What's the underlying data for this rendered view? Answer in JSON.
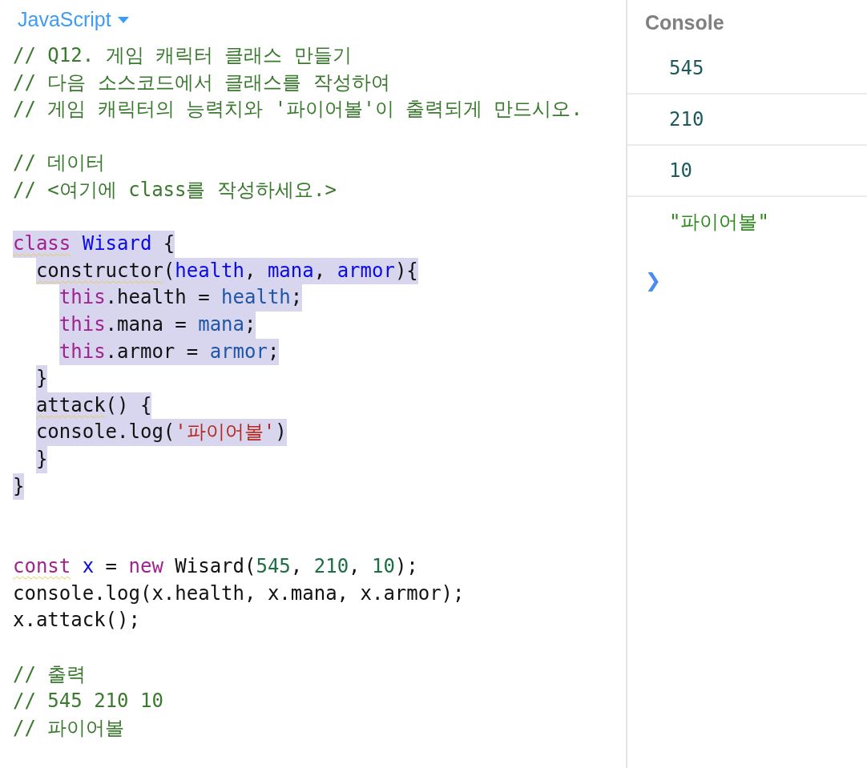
{
  "editor": {
    "language": "JavaScript",
    "lines": [
      {
        "kind": "code",
        "selected": false,
        "tokens": [
          {
            "kind": "comment",
            "text": "// Q12. 게임 캐릭터 클래스 만들기"
          }
        ]
      },
      {
        "kind": "code",
        "selected": false,
        "tokens": [
          {
            "kind": "comment",
            "text": "// 다음 소스코드에서 클래스를 작성하여"
          }
        ]
      },
      {
        "kind": "code",
        "selected": false,
        "tokens": [
          {
            "kind": "comment",
            "text": "// 게임 캐릭터의 능력치와 '파이어볼'이 출력되게 만드시오."
          }
        ]
      },
      {
        "kind": "blank"
      },
      {
        "kind": "code",
        "selected": false,
        "tokens": [
          {
            "kind": "comment",
            "text": "// 데이터"
          }
        ]
      },
      {
        "kind": "code",
        "selected": false,
        "tokens": [
          {
            "kind": "comment",
            "text": "// <여기에 class를 작성하세요.>"
          }
        ]
      },
      {
        "kind": "blank"
      },
      {
        "kind": "code",
        "selected": true,
        "tokens": [
          {
            "kind": "keyword",
            "text": "class",
            "flagged": true
          },
          {
            "kind": "def",
            "text": " Wisard"
          },
          {
            "kind": "plain",
            "text": " {"
          }
        ]
      },
      {
        "kind": "code",
        "selected": true,
        "tokens": [
          {
            "kind": "plain",
            "text": "  constructor",
            "flagged": true
          },
          {
            "kind": "plain",
            "text": "("
          },
          {
            "kind": "def",
            "text": "health"
          },
          {
            "kind": "plain",
            "text": ", "
          },
          {
            "kind": "def",
            "text": "mana"
          },
          {
            "kind": "plain",
            "text": ", "
          },
          {
            "kind": "def",
            "text": "armor"
          },
          {
            "kind": "plain",
            "text": "){"
          }
        ]
      },
      {
        "kind": "code",
        "selected": true,
        "tokens": [
          {
            "kind": "keyword",
            "text": "    this"
          },
          {
            "kind": "plain",
            "text": ".health = "
          },
          {
            "kind": "variable",
            "text": "health"
          },
          {
            "kind": "plain",
            "text": ";"
          }
        ]
      },
      {
        "kind": "code",
        "selected": true,
        "tokens": [
          {
            "kind": "keyword",
            "text": "    this"
          },
          {
            "kind": "plain",
            "text": ".mana = "
          },
          {
            "kind": "variable",
            "text": "mana"
          },
          {
            "kind": "plain",
            "text": ";"
          }
        ]
      },
      {
        "kind": "code",
        "selected": true,
        "tokens": [
          {
            "kind": "keyword",
            "text": "    this"
          },
          {
            "kind": "plain",
            "text": ".armor = "
          },
          {
            "kind": "variable",
            "text": "armor"
          },
          {
            "kind": "plain",
            "text": ";"
          }
        ]
      },
      {
        "kind": "code",
        "selected": true,
        "tokens": [
          {
            "kind": "plain",
            "text": "  }"
          }
        ]
      },
      {
        "kind": "code",
        "selected": true,
        "tokens": [
          {
            "kind": "plain",
            "text": "  attack",
            "flagged": true
          },
          {
            "kind": "plain",
            "text": "() {"
          }
        ]
      },
      {
        "kind": "code",
        "selected": true,
        "tokens": [
          {
            "kind": "plain",
            "text": "  console.log("
          },
          {
            "kind": "string",
            "text": "'파이어볼'"
          },
          {
            "kind": "plain",
            "text": ")"
          }
        ]
      },
      {
        "kind": "code",
        "selected": true,
        "tokens": [
          {
            "kind": "plain",
            "text": "  }"
          }
        ]
      },
      {
        "kind": "code",
        "selected": true,
        "tokens": [
          {
            "kind": "plain",
            "text": "}"
          }
        ]
      },
      {
        "kind": "blank"
      },
      {
        "kind": "blank"
      },
      {
        "kind": "code",
        "selected": false,
        "tokens": [
          {
            "kind": "keyword",
            "text": "const",
            "flagged": true
          },
          {
            "kind": "def",
            "text": " x"
          },
          {
            "kind": "plain",
            "text": " = "
          },
          {
            "kind": "keyword",
            "text": "new"
          },
          {
            "kind": "plain",
            "text": " Wisard("
          },
          {
            "kind": "number",
            "text": "545"
          },
          {
            "kind": "plain",
            "text": ", "
          },
          {
            "kind": "number",
            "text": "210"
          },
          {
            "kind": "plain",
            "text": ", "
          },
          {
            "kind": "number",
            "text": "10"
          },
          {
            "kind": "plain",
            "text": ");"
          }
        ]
      },
      {
        "kind": "code",
        "selected": false,
        "tokens": [
          {
            "kind": "plain",
            "text": "console.log(x.health, x.mana, x.armor);"
          }
        ]
      },
      {
        "kind": "code",
        "selected": false,
        "tokens": [
          {
            "kind": "plain",
            "text": "x.attack();"
          }
        ]
      },
      {
        "kind": "blank"
      },
      {
        "kind": "code",
        "selected": false,
        "tokens": [
          {
            "kind": "comment",
            "text": "// 출력"
          }
        ]
      },
      {
        "kind": "code",
        "selected": false,
        "tokens": [
          {
            "kind": "comment",
            "text": "// 545 210 10"
          }
        ]
      },
      {
        "kind": "code",
        "selected": false,
        "tokens": [
          {
            "kind": "comment",
            "text": "// 파이어볼"
          }
        ]
      }
    ]
  },
  "console": {
    "title": "Console",
    "entries": [
      {
        "kind": "number",
        "text": "545"
      },
      {
        "kind": "number",
        "text": "210"
      },
      {
        "kind": "number",
        "text": "10"
      },
      {
        "kind": "string",
        "text": "\"파이어볼\""
      }
    ],
    "prompt": "❯"
  }
}
